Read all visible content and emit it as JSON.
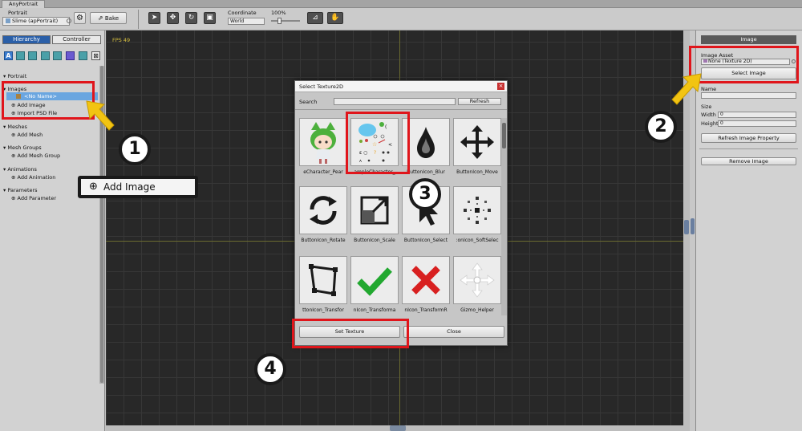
{
  "window": {
    "title": "AnyPortrait"
  },
  "toolbar": {
    "portrait_label": "Portrait",
    "portrait_value": "Slime (apPortrait)",
    "bake_label": "Bake",
    "coordinate_label": "Coordinate",
    "coordinate_value": "World",
    "zoom": "100%"
  },
  "left_panel": {
    "tabs": [
      "Hierarchy",
      "Controller"
    ],
    "tree": {
      "portrait": "Portrait",
      "images": "Images",
      "no_name": "<No Name>",
      "add_image": "Add Image",
      "import_psd": "Import PSD File",
      "meshes": "Meshes",
      "add_mesh": "Add Mesh",
      "mesh_groups": "Mesh Groups",
      "add_mesh_group": "Add Mesh Group",
      "animations": "Animations",
      "add_animation": "Add Animation",
      "parameters": "Parameters",
      "add_parameter": "Add Parameter"
    }
  },
  "canvas": {
    "fps": "FPS 49"
  },
  "callout": {
    "add_image": "Add Image"
  },
  "right_panel": {
    "header": "Image",
    "image_asset_label": "Image Asset",
    "image_asset_value": "None (Texture 2D)",
    "select_image": "Select Image",
    "name_label": "Name",
    "size_label": "Size",
    "width_label": "Width",
    "width_value": "0",
    "height_label": "Height",
    "height_value": "0",
    "refresh_property": "Refresh Image Property",
    "remove_image": "Remove Image"
  },
  "dialog": {
    "title": "Select Texture2D",
    "search_label": "Search",
    "refresh": "Refresh",
    "tiles": [
      "eCharacter_Pear",
      "ampleCharacter_",
      "ButtonIcon_Blur",
      "ButtonIcon_Move",
      "ButtonIcon_Rotate",
      "ButtonIcon_Scale",
      "ButtonIcon_Select",
      ":onIcon_SoftSelec",
      "ttonIcon_Transfor",
      "nIcon_Transforma",
      "nIcon_TransformR",
      "Gizmo_Helper"
    ],
    "set_texture": "Set Texture",
    "close": "Close"
  },
  "steps": [
    "1",
    "2",
    "3",
    "4"
  ],
  "colors": {
    "highlight_red": "#e0151b",
    "arrow_yellow": "#f2c412",
    "selection_blue": "#6aa6e0",
    "canvas_bg": "#282828"
  }
}
